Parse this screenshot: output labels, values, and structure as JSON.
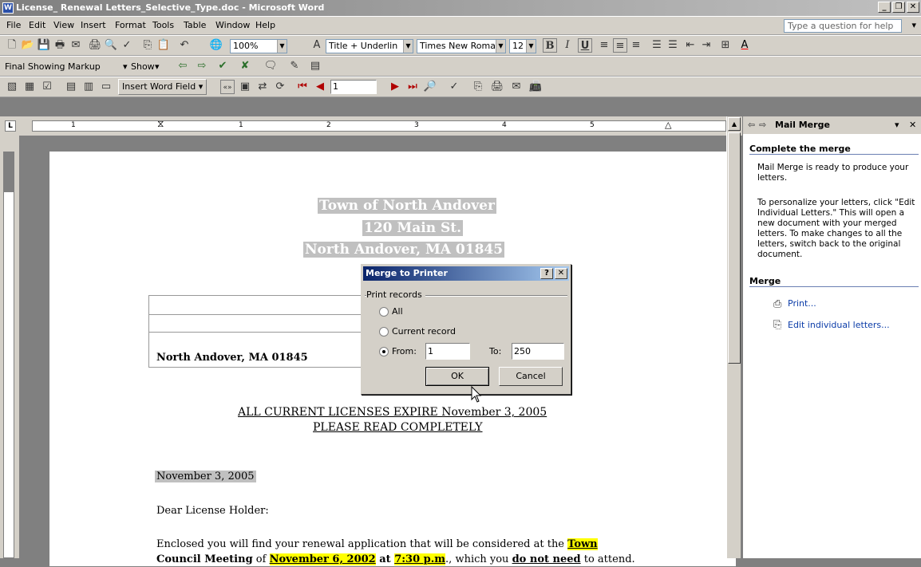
{
  "window": {
    "title": "License_ Renewal Letters_Selective_Type.doc - Microsoft Word",
    "app_icon": "W"
  },
  "menu": {
    "items": [
      "File",
      "Edit",
      "View",
      "Insert",
      "Format",
      "Tools",
      "Table",
      "Window",
      "Help"
    ],
    "help_placeholder": "Type a question for help"
  },
  "toolbar": {
    "zoom": "100%",
    "style": "Title + Underlin",
    "font": "Times New Roman",
    "size": "12",
    "markup": "Final Showing Markup",
    "show_label": "Show",
    "insert_word_field": "Insert Word Field",
    "record": "1"
  },
  "ruler": {
    "numbers": [
      "1",
      "1",
      "2",
      "3",
      "4",
      "5"
    ]
  },
  "document": {
    "header_lines": [
      "Town of North Andover",
      "120 Main St.",
      "North Andover, MA 01845"
    ],
    "address_line": "North Andover,  MA 01845",
    "notice_line1": "ALL CURRENT LICENSES EXPIRE November 3, 2005",
    "notice_line2": "PLEASE READ COMPLETELY",
    "date": "November 3, 2005",
    "salutation": "Dear License Holder:",
    "body_p1_a": "Enclosed you will find your renewal application that will be considered at the ",
    "body_p1_b": "Town",
    "body_p1_c": "Council Meeting",
    "body_p1_d": " of ",
    "body_p1_e": "November 6, 2002",
    "body_p1_f": " at ",
    "body_p1_g": "7:30 p.m",
    "body_p1_h": "., which you ",
    "body_p1_i": "do not need",
    "body_p1_j": " to attend."
  },
  "taskpane": {
    "title": "Mail Merge",
    "section1": "Complete the merge",
    "text1": "Mail Merge is ready to produce your letters.",
    "text2": "To personalize your letters, click \"Edit Individual Letters.\" This will open a new document with your merged letters. To make changes to all the letters, switch back to the original document.",
    "section2": "Merge",
    "link_print": "Print...",
    "link_edit": "Edit individual letters..."
  },
  "dialog": {
    "title": "Merge to Printer",
    "group_label": "Print records",
    "opt_all": "All",
    "opt_current": "Current record",
    "opt_from": "From:",
    "from_value": "1",
    "to_label": "To:",
    "to_value": "250",
    "ok": "OK",
    "cancel": "Cancel",
    "selected": "from"
  }
}
